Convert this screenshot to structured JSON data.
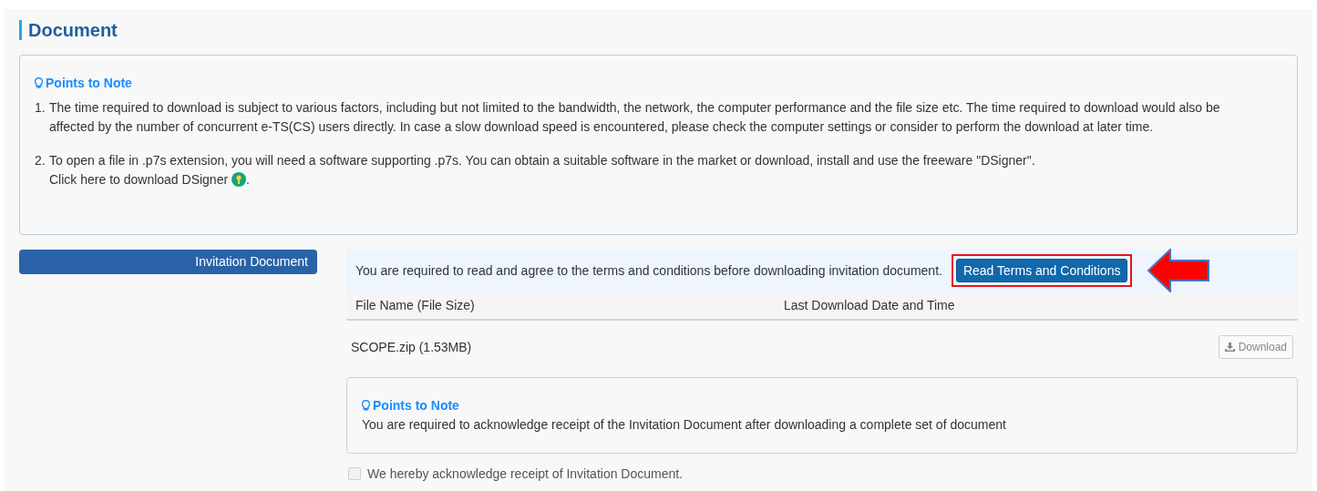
{
  "title": "Document",
  "notes": {
    "heading": "Points to Note",
    "markers": [
      "1.",
      "2."
    ],
    "items": [
      "The time required to download is subject to various factors, including but not limited to the bandwidth, the network, the computer performance and the file size etc. The time required to download would also be affected by the number of concurrent e-TS(CS) users directly. In case a slow download speed is encountered, please check the computer settings or consider to perform the download at later time.",
      "To open a file in .p7s extension, you will need a software supporting .p7s. You can obtain a suitable software in the market or download, install and use the freeware \"DSigner\"."
    ],
    "download_link": "Click here to download DSigner",
    "link_end": "."
  },
  "section": {
    "label": "Invitation Document",
    "terms": {
      "text": "You are required to read and agree to the terms and conditions before downloading invitation document.",
      "button": "Read Terms and Conditions",
      "highlighted": true
    },
    "table": {
      "columns": [
        "File Name (File Size)",
        "Last Download Date and Time"
      ],
      "rows": [
        {
          "file": "SCOPE.zip (1.53MB)",
          "action": "Download",
          "disabled": true
        }
      ]
    },
    "note": {
      "heading": "Points to Note",
      "text": "You are required to acknowledge receipt of the Invitation Document after downloading a complete set of document"
    },
    "acknowledge": {
      "label": "We hereby acknowledge receipt of Invitation Document.",
      "checked": false,
      "disabled": true
    }
  }
}
